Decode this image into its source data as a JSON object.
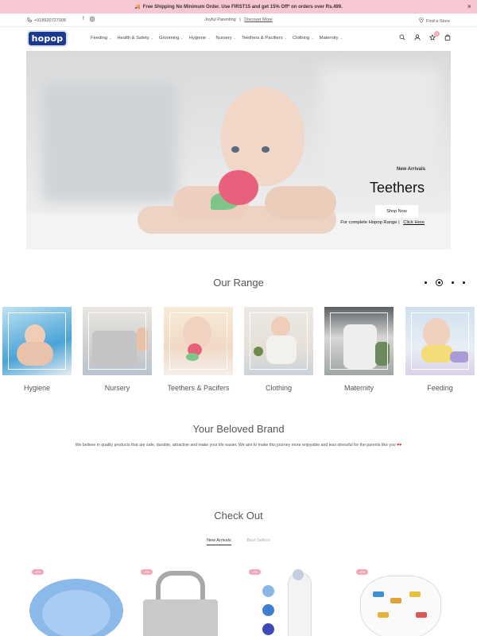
{
  "announcement": {
    "text": "Free Shipping No Minimum Order. Use FIRST15 and get 15% Off* on orders over Rs.499.",
    "close_icon": "×"
  },
  "utility": {
    "phone": "+918920727008",
    "tagline": "Joyful Parenting",
    "divider": "|",
    "discover": "Discover More",
    "find_store": "Find a Store"
  },
  "header": {
    "logo": "hopop",
    "nav": [
      "Feeding",
      "Health & Safety",
      "Grooming",
      "Hygiene",
      "Nursery",
      "Teethers & Pacifiers",
      "Clothing",
      "Maternity"
    ],
    "wishlist_count": "0"
  },
  "hero": {
    "kicker": "New Arrivals",
    "title": "Teethers",
    "button": "Shop Now",
    "range_text": "For complete Hopop Range",
    "divider": "|",
    "range_link": "Click Here"
  },
  "our_range": {
    "title": "Our Range",
    "items": [
      "Hygiene",
      "Nursery",
      "Teethers & Pacifers",
      "Clothing",
      "Maternity",
      "Feeding"
    ]
  },
  "brand": {
    "title": "Your Beloved Brand",
    "text": "We believe in quality products that are safe, durable, attractive and make your life easier. We aim to make this journey more enjoyable and less stressful for the parents like you",
    "hearts": "♥♥"
  },
  "check_out": {
    "title": "Check Out",
    "tabs": [
      "New Arrivals",
      "Best Sellers"
    ],
    "active_tab": "New Arrivals"
  },
  "products": [
    {
      "tag": "-9%"
    },
    {
      "tag": "-9%"
    },
    {
      "tag": "-9%"
    },
    {
      "tag": "-9%"
    }
  ],
  "colors": {
    "announcement_bg": "#f7c8d4",
    "brand_blue": "#1b3a8c",
    "badge_pink": "#f4a7b8",
    "heart_red": "#d61f2c"
  }
}
